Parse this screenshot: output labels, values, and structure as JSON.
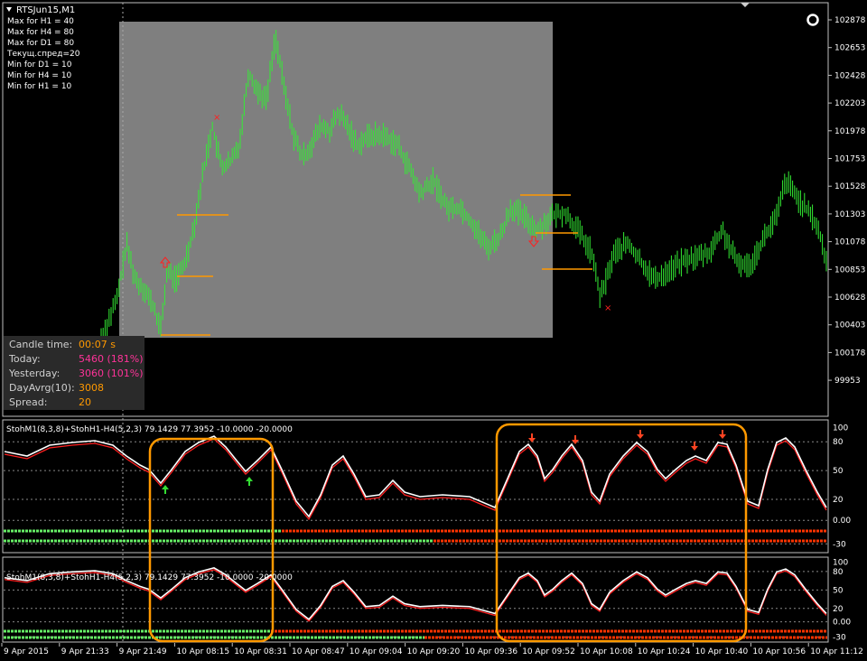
{
  "window": {
    "symbol_title": "RTSJun15,M1",
    "settings_icon": "ring-icon",
    "collapse_icon": "triangle-down-icon"
  },
  "overlay_lines": [
    "Max for H1 = 40",
    "Max for H4 = 80",
    "Max for D1 = 80",
    "Текущ.спред=20",
    "Min for D1 = 10",
    "Min for H4 = 10",
    "Min for H1 = 10"
  ],
  "price_axis": [
    "102878",
    "102653",
    "102428",
    "102203",
    "101978",
    "101753",
    "101528",
    "101303",
    "101078",
    "100853",
    "100628",
    "100403",
    "100178",
    "99953"
  ],
  "info_panel": [
    {
      "label": "Candle time:",
      "value": "00:07 s",
      "color": "#ff9900"
    },
    {
      "label": "Today:",
      "value": "5460 (181%)",
      "color": "#ff3399"
    },
    {
      "label": "Yesterday:",
      "value": "3060 (101%)",
      "color": "#ff3399"
    },
    {
      "label": "DayAvrg(10):",
      "value": "3008",
      "color": "#ff9900"
    },
    {
      "label": "Spread:",
      "value": "20",
      "color": "#ff9900"
    }
  ],
  "indicator1": {
    "title": "StohM1(8,3,8)+StohH1-H4(5,2,3) 79.1429 77.3952 -10.0000 -20.0000",
    "levels": [
      "100",
      "80",
      "50",
      "20",
      "0.00",
      "-30"
    ]
  },
  "indicator2": {
    "title": "StohM1(8,3,8)+StohH1-H4(5,2,3) 79.1429 77.3952 -10.0000 -20.0000",
    "levels": [
      "100",
      "80",
      "50",
      "20",
      "0.00",
      "-30"
    ]
  },
  "time_axis": [
    "9 Apr 2015",
    "9 Apr 21:33",
    "9 Apr 21:49",
    "10 Apr 08:15",
    "10 Apr 08:31",
    "10 Apr 08:47",
    "10 Apr 09:04",
    "10 Apr 09:20",
    "10 Apr 09:36",
    "10 Apr 09:52",
    "10 Apr 10:08",
    "10 Apr 10:24",
    "10 Apr 10:40",
    "10 Apr 10:56",
    "10 Apr 11:12"
  ],
  "colors": {
    "candles": "#33ee33",
    "grey_box": "#7f7f7f",
    "level_lines": "#ff9900",
    "highlight": "#ff9900",
    "stoch_main": "#ffffff",
    "stoch_signal": "#ff2020",
    "bar_bull": "#66ee66",
    "bar_bear": "#ff3300"
  }
}
